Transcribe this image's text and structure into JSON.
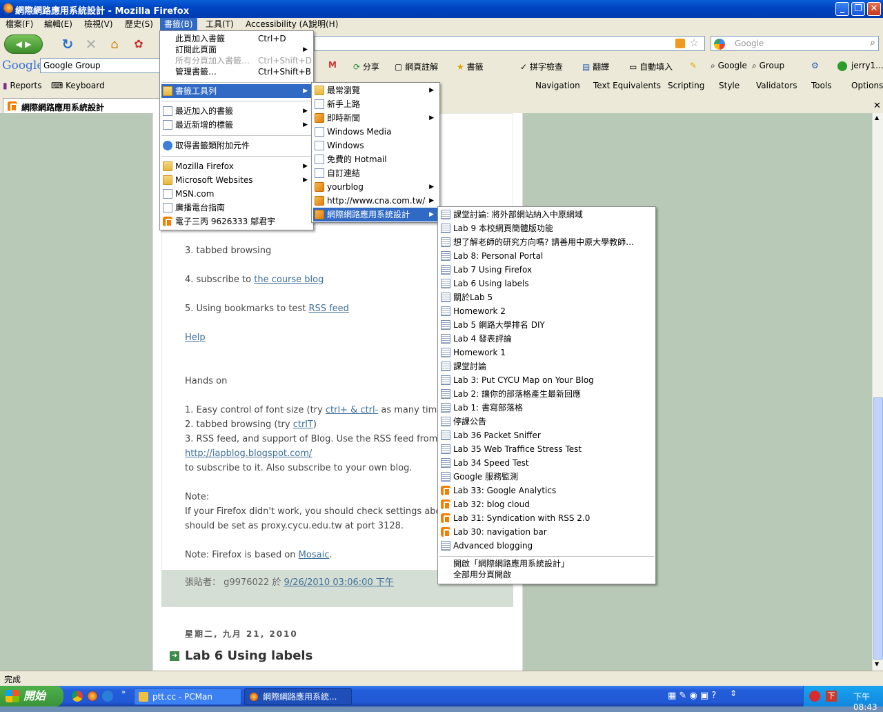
{
  "window": {
    "title": "網際網路應用系統設計 - Mozilla Firefox"
  },
  "menubar": {
    "items": [
      {
        "label": "檔案(F)"
      },
      {
        "label": "編輯(E)"
      },
      {
        "label": "檢視(V)"
      },
      {
        "label": "歷史(S)"
      },
      {
        "label": "書籤(B)"
      },
      {
        "label": "工具(T)"
      },
      {
        "label": "Accessibility (A)"
      },
      {
        "label": "說明(H)"
      }
    ]
  },
  "search": {
    "placeholder": "Google"
  },
  "google_toolbar": {
    "logo": "Google",
    "query": "Google Group",
    "items": [
      "分享",
      "網頁註解",
      "書籤",
      "拼字檢查",
      "翻譯",
      "自動填入",
      "Google",
      "Group",
      "jerry1..."
    ]
  },
  "dev_toolbar": {
    "left": [
      "Reports",
      "Keyboard"
    ],
    "right": [
      "Navigation",
      "Text Equivalents",
      "Scripting",
      "Style",
      "Validators",
      "Tools",
      "Options"
    ]
  },
  "tab": {
    "title": "網際網路應用系統設計"
  },
  "bookmarks_menu": {
    "items": [
      {
        "label": "此頁加入書籤",
        "shortcut": "Ctrl+D"
      },
      {
        "label": "訂閱此頁面"
      },
      {
        "label": "所有分頁加入書籤…",
        "shortcut": "Ctrl+Shift+D"
      },
      {
        "label": "管理書籤…",
        "shortcut": "Ctrl+Shift+B"
      },
      {
        "label": "書籤工具列"
      },
      {
        "label": "最近加入的書籤"
      },
      {
        "label": "最近新增的標籤"
      },
      {
        "label": "取得書籤類附加元件"
      },
      {
        "label": "Mozilla Firefox"
      },
      {
        "label": "Microsoft Websites"
      },
      {
        "label": "MSN.com"
      },
      {
        "label": "廣播電台指南"
      },
      {
        "label": "電子三丙 9626333 鄔君宇"
      }
    ]
  },
  "toolbar_submenu": {
    "items": [
      "最常瀏覽",
      "新手上路",
      "即時新聞",
      "Windows Media",
      "Windows",
      "免費的 Hotmail",
      "自訂連結",
      "yourblog",
      "http://www.cna.com.tw/",
      "網際網路應用系統設計"
    ]
  },
  "feed_submenu": {
    "items": [
      "課堂討論: 將外部網站納入中原網域",
      "Lab 9 本校網頁簡體版功能",
      "想了解老師的研究方向嗎? 請善用中原大學教師…",
      "Lab 8: Personal Portal",
      "Lab 7 Using Firefox",
      "Lab 6 Using labels",
      "關於Lab 5",
      "Homework 2",
      "Lab 5 網路大學排名 DIY",
      "Lab 4 發表評論",
      "Homework 1",
      "課堂討論",
      "Lab 3: Put CYCU Map on Your Blog",
      "Lab 2: 讓你的部落格產生最新回應",
      "Lab 1: 書寫部落格",
      "停課公告",
      "Lab 36 Packet Sniffer",
      "Lab 35 Web Traffice Stress Test",
      "Lab 34 Speed Test",
      "Google 服務監測",
      "Lab 33: Google Analytics",
      "Lab 32: blog cloud",
      "Lab 31: Syndication with RSS 2.0",
      "Lab 30: navigation bar",
      "Advanced blogging"
    ],
    "footer": [
      "開啟「網際網路應用系統設計」",
      "全部用分頁開啟"
    ]
  },
  "content": {
    "l1": "3. tabbed browsing",
    "l2a": "4. subscribe to ",
    "l2b": "the course blog",
    "l3a": "5. Using bookmarks to test ",
    "l3b": "RSS feed",
    "help": "Help",
    "hands": "Hands on",
    "h1a": "1. Easy control of font size (try ",
    "h1b": "ctrl+ & ctrl-",
    "h1c": " as many times",
    "h2a": "2. tabbed browsing (try ",
    "h2b": "ctrlT",
    "h2c": ")",
    "h3": "3. RSS feed, and support of Blog. Use the RSS feed from",
    "h3url": "http://iapblog.blogspot.com/",
    "h4": "to subscribe to it. Also subscribe to your own blog.",
    "note1": "Note:",
    "note2": "If your Firefox didn't work, you should check settings abo",
    "note3": "should be set as proxy.cycu.edu.tw at port 3128.",
    "note4a": "Note: Firefox is based on ",
    "note4b": "Mosaic",
    "note4c": ".",
    "posted_a": "張貼者： g9976022 於 ",
    "posted_b": "9/26/2010 03:06:00 下午",
    "date": "星期二, 九月 21, 2010",
    "next_title": "Lab 6 Using labels"
  },
  "status": {
    "text": "完成"
  },
  "taskbar": {
    "start": "開始",
    "tasks": [
      "ptt.cc - PCMan",
      "網際網路應用系統..."
    ],
    "clock": "下午 08:43"
  }
}
